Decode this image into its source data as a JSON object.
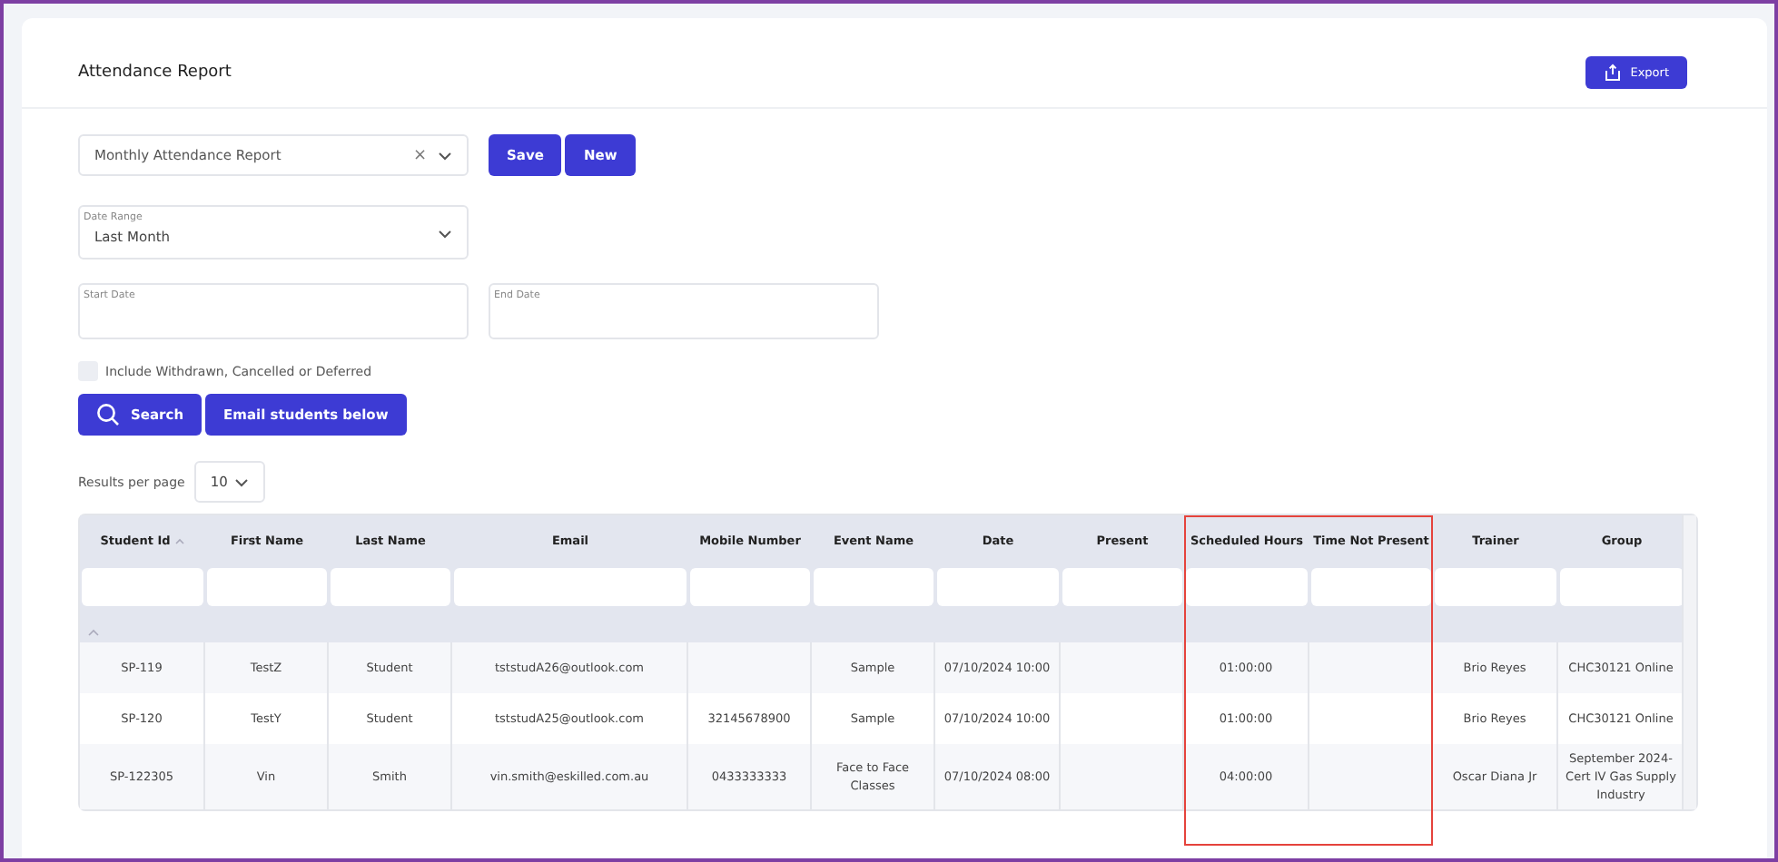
{
  "page": {
    "title": "Attendance Report",
    "export_button": "Export"
  },
  "report_select": {
    "value": "Monthly Attendance Report",
    "clear": "×"
  },
  "buttons": [
    "Save",
    "New"
  ],
  "date_range": {
    "label": "Date Range",
    "value": "Last Month"
  },
  "date_fields": [
    {
      "label": "Start Date"
    },
    {
      "label": "End Date"
    }
  ],
  "include_checkbox": {
    "label": "Include Withdrawn, Cancelled or Deferred",
    "checked": false
  },
  "action_buttons": [
    {
      "label": "Search",
      "kind": "search"
    },
    {
      "label": "Email students below",
      "kind": "plain"
    }
  ],
  "results_per_page": {
    "label": "Results per page",
    "value": "10"
  },
  "table": {
    "columns": [
      {
        "label": "Student Id",
        "sorted": true,
        "highlighted": false
      },
      {
        "label": "First Name",
        "sorted": false,
        "highlighted": false
      },
      {
        "label": "Last Name",
        "sorted": false,
        "highlighted": false
      },
      {
        "label": "Email",
        "sorted": false,
        "highlighted": false
      },
      {
        "label": "Mobile Number",
        "sorted": false,
        "highlighted": false
      },
      {
        "label": "Event Name",
        "sorted": false,
        "highlighted": false
      },
      {
        "label": "Date",
        "sorted": false,
        "highlighted": false
      },
      {
        "label": "Present",
        "sorted": false,
        "highlighted": false
      },
      {
        "label": "Scheduled Hours",
        "sorted": false,
        "highlighted": true
      },
      {
        "label": "Time Not Present",
        "sorted": false,
        "highlighted": true
      },
      {
        "label": "Trainer",
        "sorted": false,
        "highlighted": false
      },
      {
        "label": "Group",
        "sorted": false,
        "highlighted": false
      }
    ],
    "rows": [
      [
        "SP-119",
        "TestZ",
        "Student",
        "tststudA26@outlook.com",
        "",
        "Sample",
        "07/10/2024 10:00",
        "",
        "01:00:00",
        "",
        "Brio Reyes",
        "CHC30121 Online"
      ],
      [
        "SP-120",
        "TestY",
        "Student",
        "tststudA25@outlook.com",
        "32145678900",
        "Sample",
        "07/10/2024 10:00",
        "",
        "01:00:00",
        "",
        "Brio Reyes",
        "CHC30121 Online"
      ],
      [
        "SP-122305",
        "Vin",
        "Smith",
        "vin.smith@eskilled.com.au",
        "0433333333",
        "Face to Face Classes",
        "07/10/2024 08:00",
        "",
        "04:00:00",
        "",
        "Oscar Diana Jr",
        "September 2024- Cert IV Gas Supply Industry"
      ]
    ]
  }
}
